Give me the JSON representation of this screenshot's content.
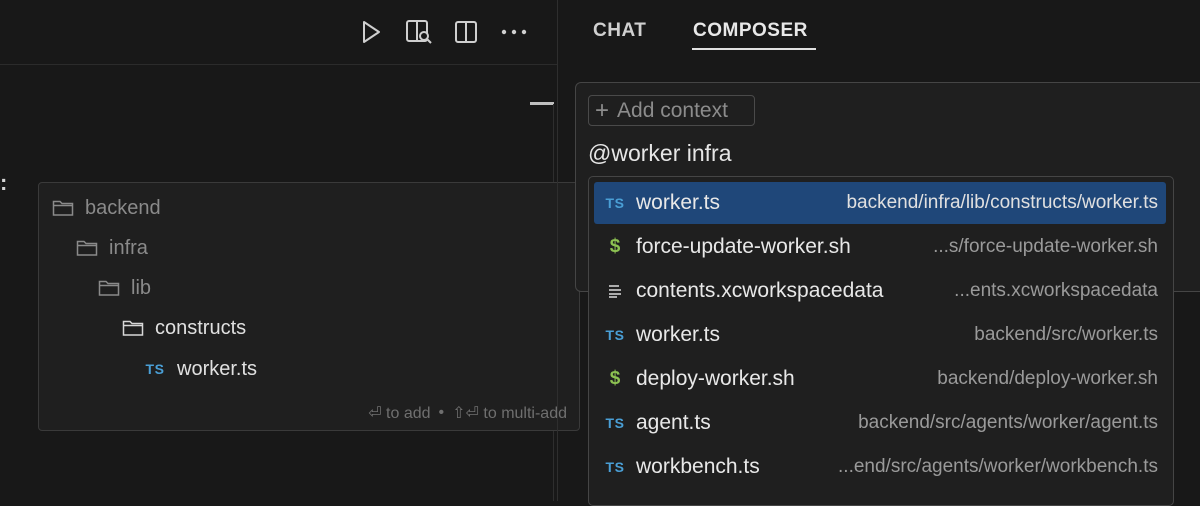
{
  "editor": {
    "colon": ":",
    "toolbar": [
      {
        "name": "run-icon"
      },
      {
        "name": "search-editor-icon"
      },
      {
        "name": "split-editor-icon"
      },
      {
        "name": "more-icon"
      }
    ]
  },
  "file_tree": {
    "rows": [
      {
        "kind": "folder",
        "label": "backend",
        "dim": true
      },
      {
        "kind": "folder",
        "label": "infra",
        "dim": true
      },
      {
        "kind": "folder",
        "label": "lib",
        "dim": true
      },
      {
        "kind": "folder",
        "label": "constructs",
        "dim": false
      },
      {
        "kind": "ts",
        "badge": "TS",
        "label": "worker.ts",
        "dim": false
      }
    ],
    "hint_add": "⏎ to add",
    "hint_sep": "•",
    "hint_multi": "⇧⏎ to multi-add"
  },
  "tabs": {
    "chat": "CHAT",
    "composer": "COMPOSER",
    "active": "composer"
  },
  "composer": {
    "add_context_plus": "+",
    "add_context_label": "Add context",
    "input_value": "@worker infra"
  },
  "suggestions": [
    {
      "icon": "ts",
      "badge": "TS",
      "name": "worker.ts",
      "path": "backend/infra/lib/constructs/worker.ts",
      "selected": true
    },
    {
      "icon": "shell",
      "badge": "$",
      "name": "force-update-worker.sh",
      "path": "...s/force-update-worker.sh",
      "selected": false
    },
    {
      "icon": "lines",
      "badge": "",
      "name": "contents.xcworkspacedata",
      "path": "...ents.xcworkspacedata",
      "selected": false
    },
    {
      "icon": "ts",
      "badge": "TS",
      "name": "worker.ts",
      "path": "backend/src/worker.ts",
      "selected": false
    },
    {
      "icon": "shell",
      "badge": "$",
      "name": "deploy-worker.sh",
      "path": "backend/deploy-worker.sh",
      "selected": false
    },
    {
      "icon": "ts",
      "badge": "TS",
      "name": "agent.ts",
      "path": "backend/src/agents/worker/agent.ts",
      "selected": false
    },
    {
      "icon": "ts",
      "badge": "TS",
      "name": "workbench.ts",
      "path": "...end/src/agents/worker/workbench.ts",
      "selected": false
    }
  ],
  "colors": {
    "background": "#181818",
    "selection": "#1f4779",
    "ts_badge": "#4a9fd6",
    "shell_badge": "#8cc152"
  }
}
